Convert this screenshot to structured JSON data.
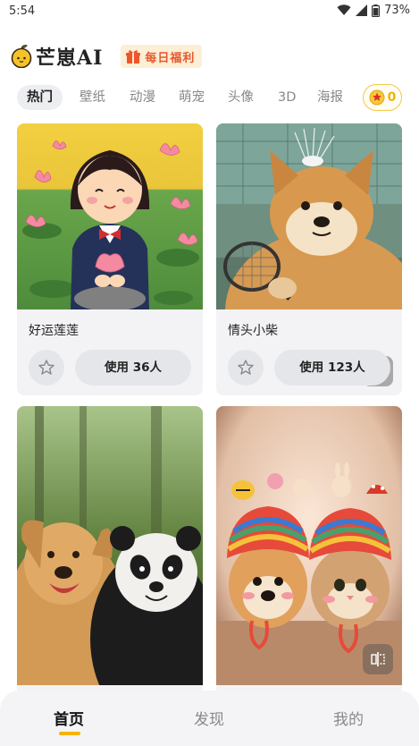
{
  "status_bar": {
    "time": "5:54",
    "battery": "73%"
  },
  "header": {
    "app_name": "芒崽AI",
    "daily_bonus": "每日福利"
  },
  "tabs": [
    {
      "label": "热门",
      "active": true
    },
    {
      "label": "壁纸"
    },
    {
      "label": "动漫"
    },
    {
      "label": "萌宠"
    },
    {
      "label": "头像"
    },
    {
      "label": "3D"
    },
    {
      "label": "海报"
    }
  ],
  "coins": {
    "count": "0"
  },
  "cards": [
    {
      "title": "好运莲莲",
      "use_label": "使用 36人"
    },
    {
      "title": "情头小柴",
      "use_label": "使用 123人"
    },
    {
      "title": "",
      "use_label": ""
    },
    {
      "title": "",
      "use_label": ""
    }
  ],
  "bottom_nav": [
    {
      "label": "首页",
      "active": true
    },
    {
      "label": "发现"
    },
    {
      "label": "我的"
    }
  ],
  "colors": {
    "accent": "#f5b400",
    "bonus_text": "#e8572d",
    "card_bg": "#f3f3f6"
  }
}
